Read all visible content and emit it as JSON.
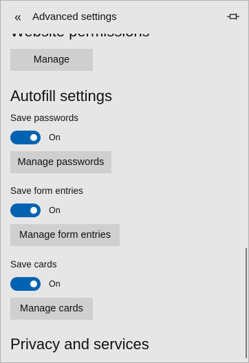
{
  "header": {
    "back_glyph": "«",
    "title": "Advanced settings",
    "pin_icon": "pin-icon"
  },
  "website_permissions": {
    "title": "Website permissions",
    "manage_label": "Manage"
  },
  "autofill": {
    "title": "Autofill settings",
    "save_passwords": {
      "label": "Save passwords",
      "state": "On",
      "button": "Manage passwords"
    },
    "save_form_entries": {
      "label": "Save form entries",
      "state": "On",
      "button": "Manage form entries"
    },
    "save_cards": {
      "label": "Save cards",
      "state": "On",
      "button": "Manage cards"
    }
  },
  "privacy": {
    "title": "Privacy and services"
  },
  "colors": {
    "toggle_on": "#0063b1",
    "button_bg": "#cfcfcf",
    "panel_bg": "#e6e6e6"
  }
}
